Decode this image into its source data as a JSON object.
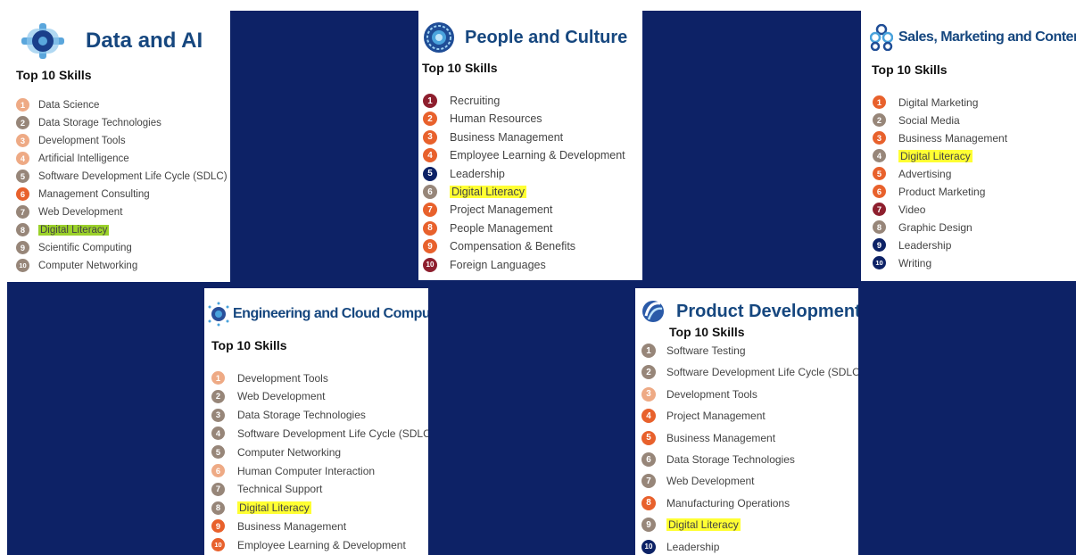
{
  "colors": {
    "navy": "#0d2266",
    "title_blue": "#16477f",
    "highlight_yellow": "#ffff33",
    "highlight_green": "#9bd12a",
    "badge_peach": "#eeaa85",
    "badge_taupe": "#978679",
    "badge_orange": "#e8612c",
    "badge_maroon": "#8e1f2e",
    "badge_navy": "#0d2266"
  },
  "cards": {
    "data_ai": {
      "title": "Data and AI",
      "icon": "gear-globe-icon",
      "subtitle": "Top 10 Skills",
      "skills": [
        {
          "num": "1",
          "label": "Data Science",
          "color": "#eeaa85"
        },
        {
          "num": "2",
          "label": "Data Storage Technologies",
          "color": "#978679"
        },
        {
          "num": "3",
          "label": "Development Tools",
          "color": "#eeaa85"
        },
        {
          "num": "4",
          "label": "Artificial Intelligence",
          "color": "#eeaa85"
        },
        {
          "num": "5",
          "label": "Software Development Life Cycle (SDLC)",
          "color": "#978679"
        },
        {
          "num": "6",
          "label": "Management Consulting",
          "color": "#e8612c"
        },
        {
          "num": "7",
          "label": "Web Development",
          "color": "#978679"
        },
        {
          "num": "8",
          "label": "Digital Literacy",
          "color": "#978679",
          "highlight": "#9bd12a"
        },
        {
          "num": "9",
          "label": "Scientific Computing",
          "color": "#978679"
        },
        {
          "num": "10",
          "label": "Computer Networking",
          "color": "#978679"
        }
      ]
    },
    "people_culture": {
      "title": "People and Culture",
      "icon": "globe-icon",
      "subtitle": "Top 10 Skills",
      "skills": [
        {
          "num": "1",
          "label": "Recruiting",
          "color": "#8e1f2e"
        },
        {
          "num": "2",
          "label": "Human Resources",
          "color": "#e8612c"
        },
        {
          "num": "3",
          "label": "Business Management",
          "color": "#e8612c"
        },
        {
          "num": "4",
          "label": "Employee Learning & Development",
          "color": "#e8612c"
        },
        {
          "num": "5",
          "label": "Leadership",
          "color": "#0d2266"
        },
        {
          "num": "6",
          "label": "Digital Literacy",
          "color": "#978679",
          "highlight": "#ffff33"
        },
        {
          "num": "7",
          "label": "Project Management",
          "color": "#e8612c"
        },
        {
          "num": "8",
          "label": "People Management",
          "color": "#e8612c"
        },
        {
          "num": "9",
          "label": "Compensation & Benefits",
          "color": "#e8612c"
        },
        {
          "num": "10",
          "label": "Foreign Languages",
          "color": "#8e1f2e"
        }
      ]
    },
    "sales_marketing": {
      "title": "Sales, Marketing and Content",
      "icon": "cluster-icon",
      "subtitle": "Top 10 Skills",
      "skills": [
        {
          "num": "1",
          "label": "Digital Marketing",
          "color": "#e8612c"
        },
        {
          "num": "2",
          "label": "Social Media",
          "color": "#978679"
        },
        {
          "num": "3",
          "label": "Business Management",
          "color": "#e8612c"
        },
        {
          "num": "4",
          "label": "Digital Literacy",
          "color": "#978679",
          "highlight": "#ffff33"
        },
        {
          "num": "5",
          "label": "Advertising",
          "color": "#e8612c"
        },
        {
          "num": "6",
          "label": "Product Marketing",
          "color": "#e8612c"
        },
        {
          "num": "7",
          "label": "Video",
          "color": "#8e1f2e"
        },
        {
          "num": "8",
          "label": "Graphic Design",
          "color": "#978679"
        },
        {
          "num": "9",
          "label": "Leadership",
          "color": "#0d2266"
        },
        {
          "num": "10",
          "label": "Writing",
          "color": "#0d2266"
        }
      ]
    },
    "engineering_cloud": {
      "title": "Engineering and Cloud Computing",
      "icon": "spark-globe-icon",
      "subtitle": "Top 10 Skills",
      "skills": [
        {
          "num": "1",
          "label": "Development Tools",
          "color": "#eeaa85"
        },
        {
          "num": "2",
          "label": "Web Development",
          "color": "#978679"
        },
        {
          "num": "3",
          "label": "Data Storage Technologies",
          "color": "#978679"
        },
        {
          "num": "4",
          "label": "Software Development Life Cycle (SDLC)",
          "color": "#978679"
        },
        {
          "num": "5",
          "label": "Computer Networking",
          "color": "#978679"
        },
        {
          "num": "6",
          "label": "Human Computer Interaction",
          "color": "#eeaa85"
        },
        {
          "num": "7",
          "label": "Technical Support",
          "color": "#978679"
        },
        {
          "num": "8",
          "label": "Digital Literacy",
          "color": "#978679",
          "highlight": "#ffff33"
        },
        {
          "num": "9",
          "label": "Business Management",
          "color": "#e8612c"
        },
        {
          "num": "10",
          "label": "Employee Learning & Development",
          "color": "#e8612c"
        }
      ]
    },
    "product_development": {
      "title": "Product Development",
      "icon": "swirl-icon",
      "subtitle": "Top 10 Skills",
      "skills": [
        {
          "num": "1",
          "label": "Software Testing",
          "color": "#978679"
        },
        {
          "num": "2",
          "label": "Software Development Life Cycle (SDLC)",
          "color": "#978679"
        },
        {
          "num": "3",
          "label": "Development Tools",
          "color": "#eeaa85"
        },
        {
          "num": "4",
          "label": "Project Management",
          "color": "#e8612c"
        },
        {
          "num": "5",
          "label": "Business Management",
          "color": "#e8612c"
        },
        {
          "num": "6",
          "label": "Data Storage Technologies",
          "color": "#978679"
        },
        {
          "num": "7",
          "label": "Web Development",
          "color": "#978679"
        },
        {
          "num": "8",
          "label": "Manufacturing Operations",
          "color": "#e8612c"
        },
        {
          "num": "9",
          "label": "Digital Literacy",
          "color": "#978679",
          "highlight": "#ffff33"
        },
        {
          "num": "10",
          "label": "Leadership",
          "color": "#0d2266"
        }
      ]
    }
  }
}
